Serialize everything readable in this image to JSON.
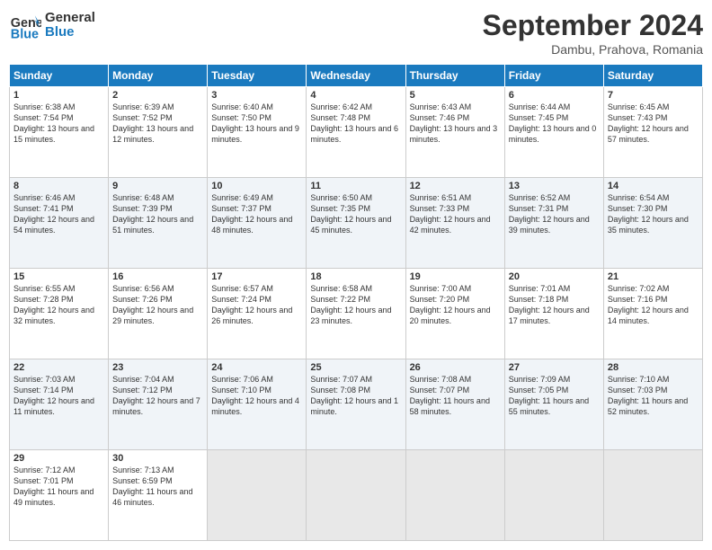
{
  "header": {
    "logo_line1": "General",
    "logo_line2": "Blue",
    "month": "September 2024",
    "location": "Dambu, Prahova, Romania"
  },
  "days_of_week": [
    "Sunday",
    "Monday",
    "Tuesday",
    "Wednesday",
    "Thursday",
    "Friday",
    "Saturday"
  ],
  "weeks": [
    [
      {
        "day": "1",
        "sunrise": "Sunrise: 6:38 AM",
        "sunset": "Sunset: 7:54 PM",
        "daylight": "Daylight: 13 hours and 15 minutes."
      },
      {
        "day": "2",
        "sunrise": "Sunrise: 6:39 AM",
        "sunset": "Sunset: 7:52 PM",
        "daylight": "Daylight: 13 hours and 12 minutes."
      },
      {
        "day": "3",
        "sunrise": "Sunrise: 6:40 AM",
        "sunset": "Sunset: 7:50 PM",
        "daylight": "Daylight: 13 hours and 9 minutes."
      },
      {
        "day": "4",
        "sunrise": "Sunrise: 6:42 AM",
        "sunset": "Sunset: 7:48 PM",
        "daylight": "Daylight: 13 hours and 6 minutes."
      },
      {
        "day": "5",
        "sunrise": "Sunrise: 6:43 AM",
        "sunset": "Sunset: 7:46 PM",
        "daylight": "Daylight: 13 hours and 3 minutes."
      },
      {
        "day": "6",
        "sunrise": "Sunrise: 6:44 AM",
        "sunset": "Sunset: 7:45 PM",
        "daylight": "Daylight: 13 hours and 0 minutes."
      },
      {
        "day": "7",
        "sunrise": "Sunrise: 6:45 AM",
        "sunset": "Sunset: 7:43 PM",
        "daylight": "Daylight: 12 hours and 57 minutes."
      }
    ],
    [
      {
        "day": "8",
        "sunrise": "Sunrise: 6:46 AM",
        "sunset": "Sunset: 7:41 PM",
        "daylight": "Daylight: 12 hours and 54 minutes."
      },
      {
        "day": "9",
        "sunrise": "Sunrise: 6:48 AM",
        "sunset": "Sunset: 7:39 PM",
        "daylight": "Daylight: 12 hours and 51 minutes."
      },
      {
        "day": "10",
        "sunrise": "Sunrise: 6:49 AM",
        "sunset": "Sunset: 7:37 PM",
        "daylight": "Daylight: 12 hours and 48 minutes."
      },
      {
        "day": "11",
        "sunrise": "Sunrise: 6:50 AM",
        "sunset": "Sunset: 7:35 PM",
        "daylight": "Daylight: 12 hours and 45 minutes."
      },
      {
        "day": "12",
        "sunrise": "Sunrise: 6:51 AM",
        "sunset": "Sunset: 7:33 PM",
        "daylight": "Daylight: 12 hours and 42 minutes."
      },
      {
        "day": "13",
        "sunrise": "Sunrise: 6:52 AM",
        "sunset": "Sunset: 7:31 PM",
        "daylight": "Daylight: 12 hours and 39 minutes."
      },
      {
        "day": "14",
        "sunrise": "Sunrise: 6:54 AM",
        "sunset": "Sunset: 7:30 PM",
        "daylight": "Daylight: 12 hours and 35 minutes."
      }
    ],
    [
      {
        "day": "15",
        "sunrise": "Sunrise: 6:55 AM",
        "sunset": "Sunset: 7:28 PM",
        "daylight": "Daylight: 12 hours and 32 minutes."
      },
      {
        "day": "16",
        "sunrise": "Sunrise: 6:56 AM",
        "sunset": "Sunset: 7:26 PM",
        "daylight": "Daylight: 12 hours and 29 minutes."
      },
      {
        "day": "17",
        "sunrise": "Sunrise: 6:57 AM",
        "sunset": "Sunset: 7:24 PM",
        "daylight": "Daylight: 12 hours and 26 minutes."
      },
      {
        "day": "18",
        "sunrise": "Sunrise: 6:58 AM",
        "sunset": "Sunset: 7:22 PM",
        "daylight": "Daylight: 12 hours and 23 minutes."
      },
      {
        "day": "19",
        "sunrise": "Sunrise: 7:00 AM",
        "sunset": "Sunset: 7:20 PM",
        "daylight": "Daylight: 12 hours and 20 minutes."
      },
      {
        "day": "20",
        "sunrise": "Sunrise: 7:01 AM",
        "sunset": "Sunset: 7:18 PM",
        "daylight": "Daylight: 12 hours and 17 minutes."
      },
      {
        "day": "21",
        "sunrise": "Sunrise: 7:02 AM",
        "sunset": "Sunset: 7:16 PM",
        "daylight": "Daylight: 12 hours and 14 minutes."
      }
    ],
    [
      {
        "day": "22",
        "sunrise": "Sunrise: 7:03 AM",
        "sunset": "Sunset: 7:14 PM",
        "daylight": "Daylight: 12 hours and 11 minutes."
      },
      {
        "day": "23",
        "sunrise": "Sunrise: 7:04 AM",
        "sunset": "Sunset: 7:12 PM",
        "daylight": "Daylight: 12 hours and 7 minutes."
      },
      {
        "day": "24",
        "sunrise": "Sunrise: 7:06 AM",
        "sunset": "Sunset: 7:10 PM",
        "daylight": "Daylight: 12 hours and 4 minutes."
      },
      {
        "day": "25",
        "sunrise": "Sunrise: 7:07 AM",
        "sunset": "Sunset: 7:08 PM",
        "daylight": "Daylight: 12 hours and 1 minute."
      },
      {
        "day": "26",
        "sunrise": "Sunrise: 7:08 AM",
        "sunset": "Sunset: 7:07 PM",
        "daylight": "Daylight: 11 hours and 58 minutes."
      },
      {
        "day": "27",
        "sunrise": "Sunrise: 7:09 AM",
        "sunset": "Sunset: 7:05 PM",
        "daylight": "Daylight: 11 hours and 55 minutes."
      },
      {
        "day": "28",
        "sunrise": "Sunrise: 7:10 AM",
        "sunset": "Sunset: 7:03 PM",
        "daylight": "Daylight: 11 hours and 52 minutes."
      }
    ],
    [
      {
        "day": "29",
        "sunrise": "Sunrise: 7:12 AM",
        "sunset": "Sunset: 7:01 PM",
        "daylight": "Daylight: 11 hours and 49 minutes."
      },
      {
        "day": "30",
        "sunrise": "Sunrise: 7:13 AM",
        "sunset": "Sunset: 6:59 PM",
        "daylight": "Daylight: 11 hours and 46 minutes."
      },
      null,
      null,
      null,
      null,
      null
    ]
  ]
}
